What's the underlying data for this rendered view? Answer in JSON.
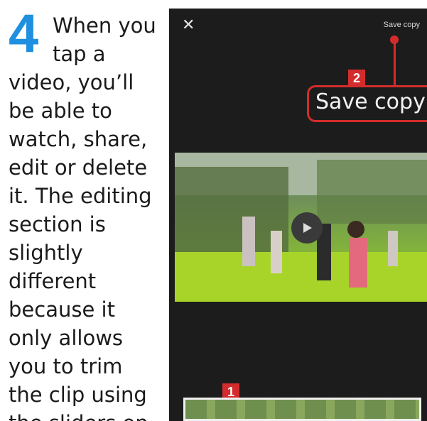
{
  "step": {
    "number": "4",
    "lines": [
      "When you",
      "tap a",
      "video, you’ll",
      "be able to",
      "watch, share,",
      "edit or delete",
      "it. The editing",
      "section is",
      "slightly",
      "different",
      "because it",
      "only allows",
      "you to trim",
      "the clip using",
      "the sliders on"
    ]
  },
  "screen": {
    "close_icon": "close-icon",
    "save_copy_small": "Save copy",
    "callout_label": "Save copy",
    "badge_1": "1",
    "badge_2": "2",
    "play_icon": "play-icon"
  },
  "colors": {
    "step_number": "#1f8fe0",
    "callout": "#d42c2c",
    "screen_bg": "#1c1c1c"
  }
}
